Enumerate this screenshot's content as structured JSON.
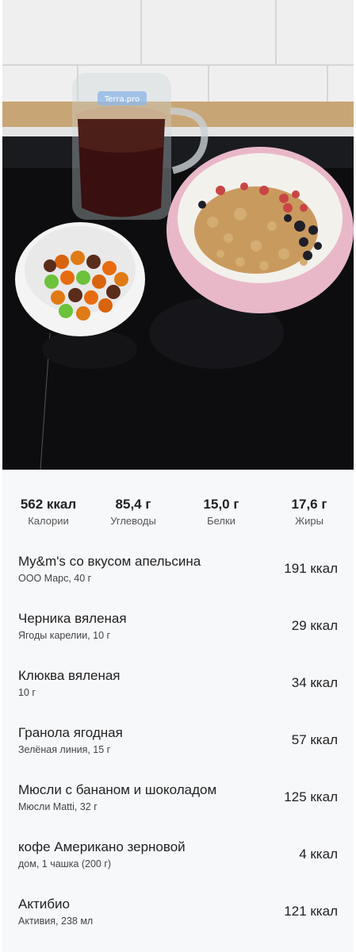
{
  "summary": {
    "calories": {
      "value": "562 ккал",
      "label": "Калории"
    },
    "carbs": {
      "value": "85,4 г",
      "label": "Углеводы"
    },
    "protein": {
      "value": "15,0 г",
      "label": "Белки"
    },
    "fat": {
      "value": "17,6 г",
      "label": "Жиры"
    }
  },
  "items": [
    {
      "name": "My&m's  со вкусом апельсина",
      "sub": "ООО Марс, 40 г",
      "kcal": "191 ккал"
    },
    {
      "name": "Черника вяленая",
      "sub": "Ягоды карелии, 10 г",
      "kcal": "29 ккал"
    },
    {
      "name": "Клюква вяленая",
      "sub": "10 г",
      "kcal": "34 ккал"
    },
    {
      "name": "Гранола ягодная",
      "sub": "Зелёная линия, 15 г",
      "kcal": "57 ккал"
    },
    {
      "name": "Мюсли с бананом и шоколадом",
      "sub": "Мюсли Matti, 32 г",
      "kcal": "125 ккал"
    },
    {
      "name": "кофе Американо зерновой",
      "sub": "дом, 1 чашка (200 г)",
      "kcal": "4 ккал"
    },
    {
      "name": "Актибио",
      "sub": "Активия, 238 мл",
      "kcal": "121 ккал"
    }
  ],
  "photo": {
    "mug_brand": "Terra.pro"
  }
}
